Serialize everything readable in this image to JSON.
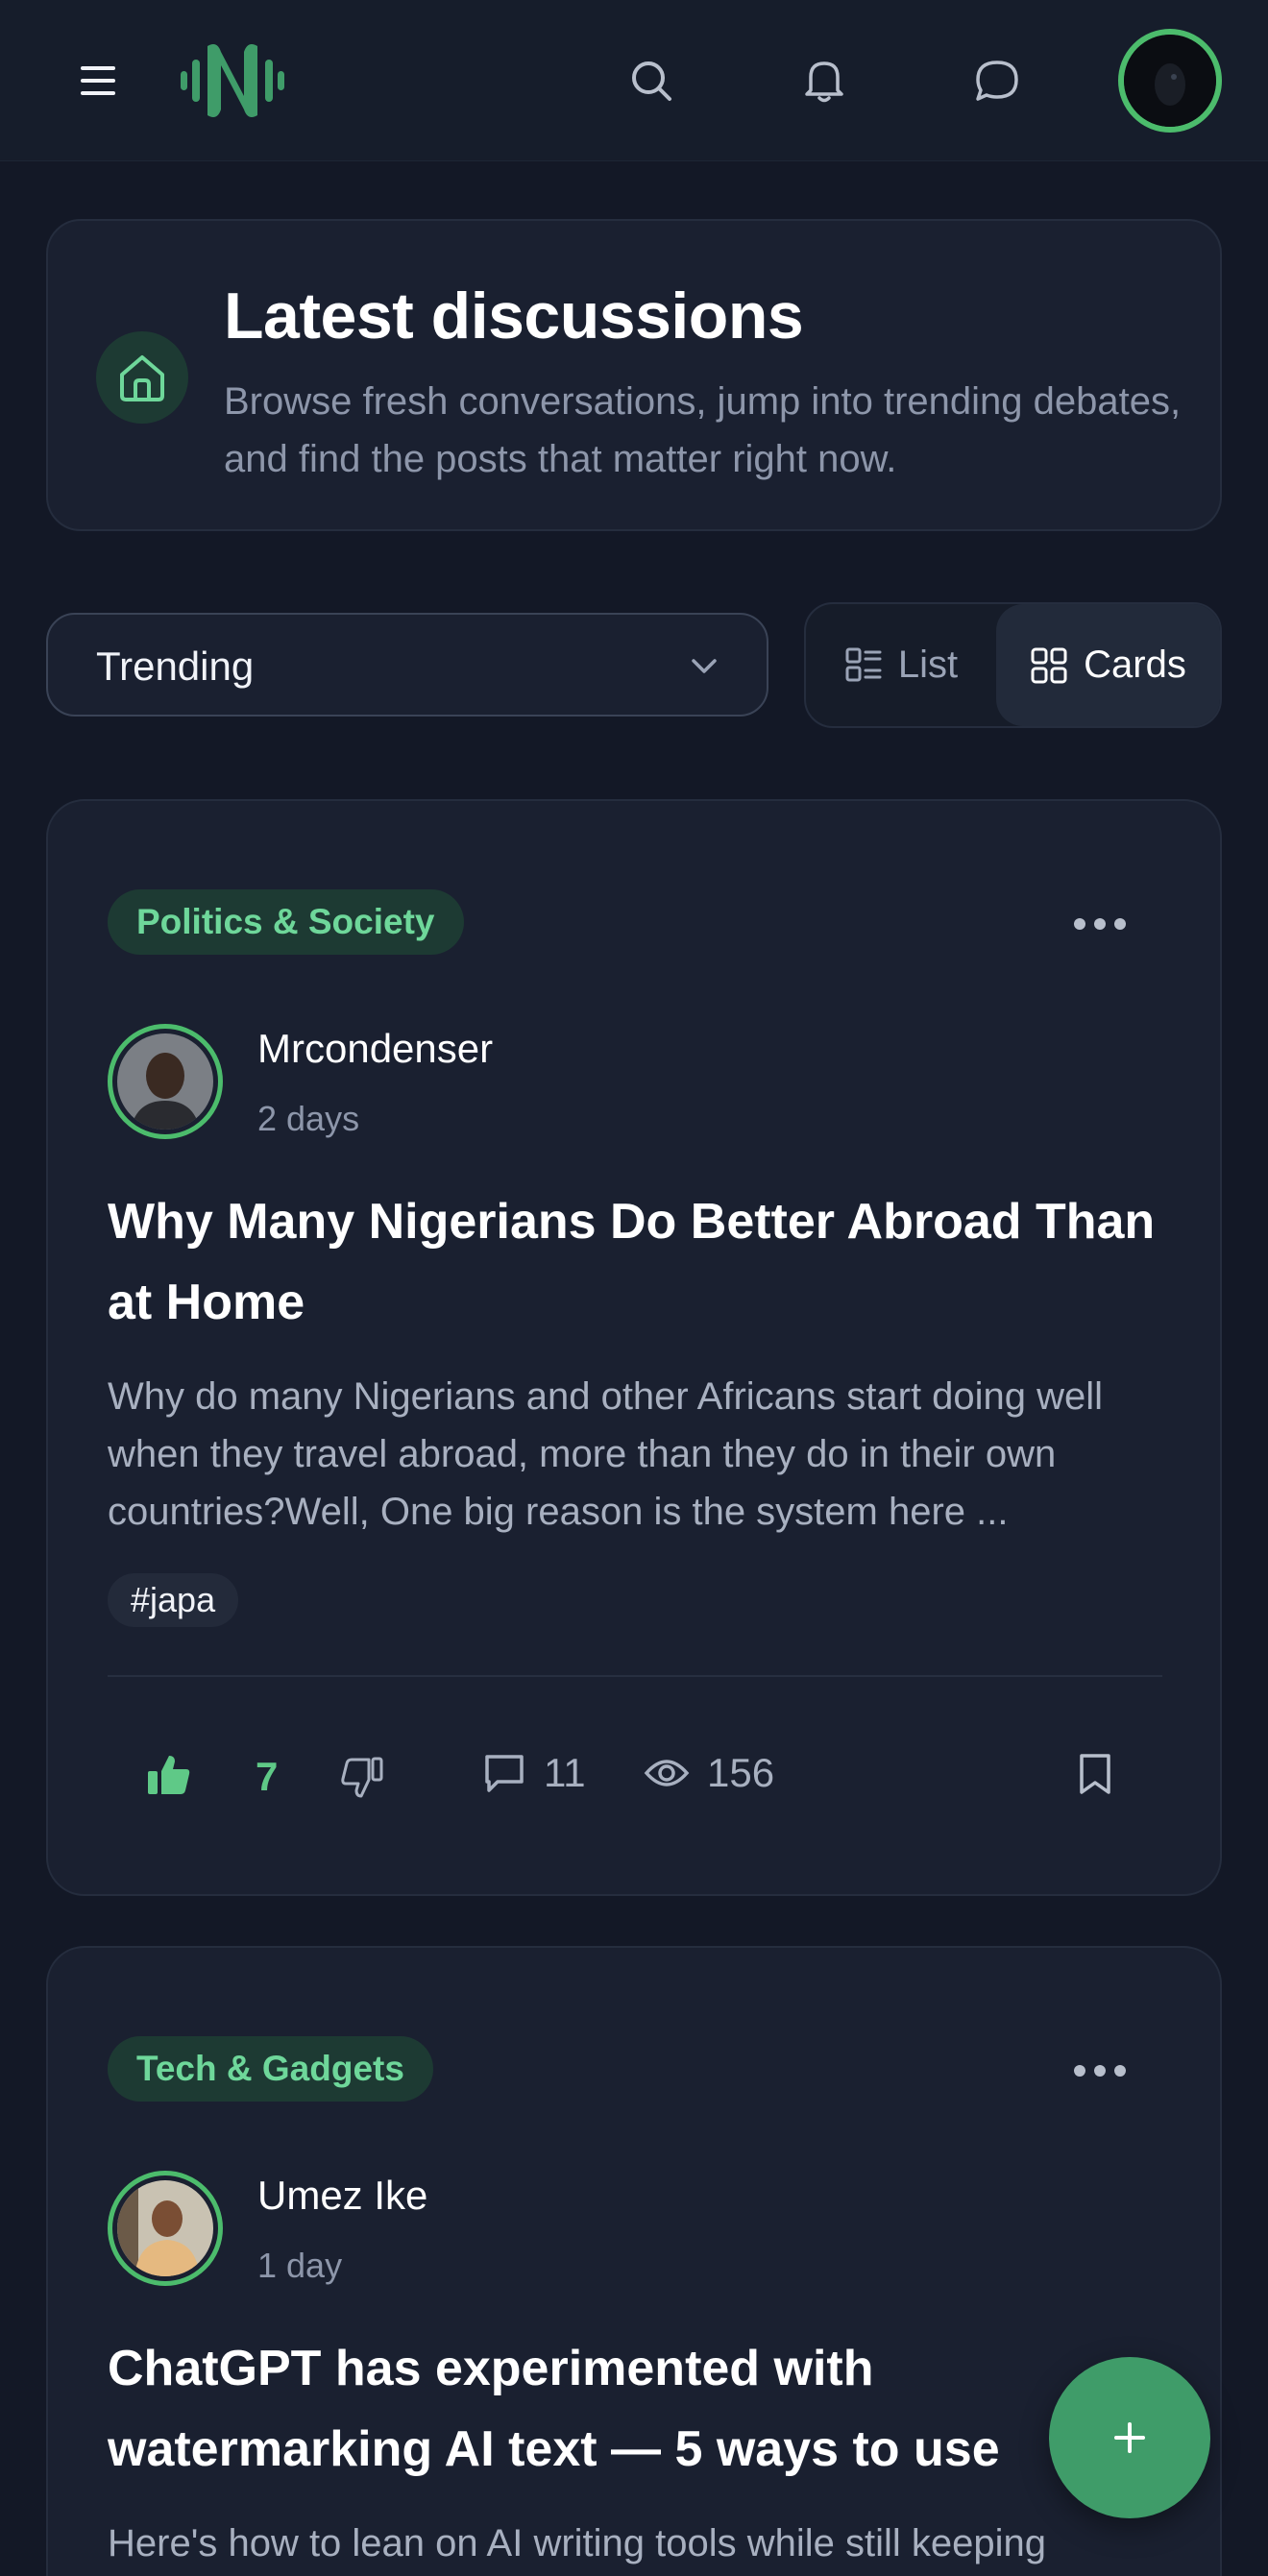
{
  "topbar": {
    "menu_icon": "hamburger-icon",
    "logo": "brand-logo",
    "search_icon": "search-icon",
    "notifications_icon": "bell-icon",
    "messages_icon": "chat-bubble-icon",
    "accent_color": "#4cbc6c"
  },
  "hero": {
    "icon": "home-icon",
    "title": "Latest discussions",
    "subtitle": "Browse fresh conversations, jump into trending debates, and find the posts that matter right now."
  },
  "controls": {
    "sort_selected": "Trending",
    "view_list_label": "List",
    "view_cards_label": "Cards",
    "active_view": "Cards"
  },
  "posts": [
    {
      "category": "Politics & Society",
      "author": "Mrcondenser",
      "time": "2 days",
      "title": "Why Many Nigerians Do Better Abroad Than at Home",
      "excerpt": "Why do many Nigerians and other Africans start doing well when they travel abroad, more than they do in their own countries?Well, One big reason is the system here ...",
      "tag": "#japa",
      "likes": "7",
      "comments": "11",
      "views": "156",
      "liked": true
    },
    {
      "category": "Tech & Gadgets",
      "author": "Umez Ike",
      "time": "1 day",
      "title": "ChatGPT has experimented with watermarking AI text — 5 ways to use",
      "excerpt": "Here's how to lean on AI writing tools while still keeping"
    }
  ],
  "fab": {
    "icon": "plus-icon"
  }
}
